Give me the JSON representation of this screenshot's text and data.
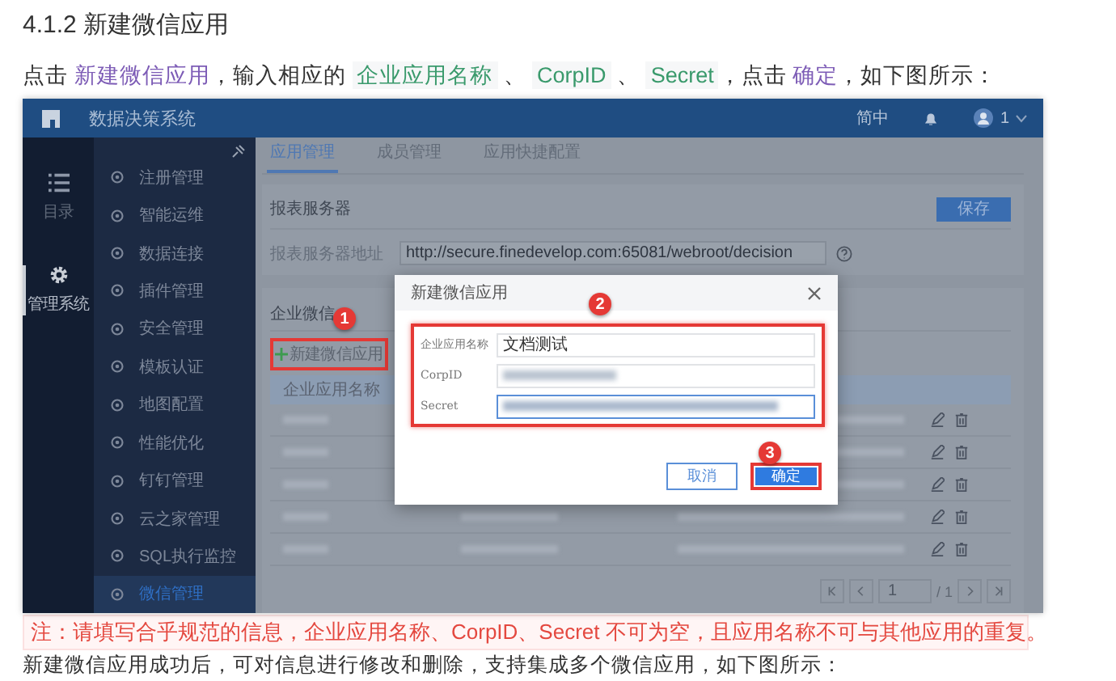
{
  "heading": "4.1.2 新建微信应用",
  "intro": [
    {
      "kind": "plain",
      "text": "点击 "
    },
    {
      "kind": "link",
      "text": "新建微信应用"
    },
    {
      "kind": "plain",
      "text": "，输入相应的 "
    },
    {
      "kind": "code",
      "text": "企业应用名称"
    },
    {
      "kind": "plain",
      "text": " 、 "
    },
    {
      "kind": "code",
      "text": "CorpID"
    },
    {
      "kind": "plain",
      "text": " 、 "
    },
    {
      "kind": "code",
      "text": "Secret"
    },
    {
      "kind": "plain",
      "text": "，点击 "
    },
    {
      "kind": "link",
      "text": "确定"
    },
    {
      "kind": "plain",
      "text": "，如下图所示："
    }
  ],
  "screenshot": {
    "topbar": {
      "title": "数据决策系统",
      "language": "简中",
      "user": "1"
    },
    "rail": [
      {
        "label": "目录",
        "selected": false
      },
      {
        "label": "管理系统",
        "selected": true
      }
    ],
    "sidebar": [
      {
        "label": "注册管理",
        "selected": false
      },
      {
        "label": "智能运维",
        "selected": false
      },
      {
        "label": "数据连接",
        "selected": false
      },
      {
        "label": "插件管理",
        "selected": false
      },
      {
        "label": "安全管理",
        "selected": false
      },
      {
        "label": "模板认证",
        "selected": false
      },
      {
        "label": "地图配置",
        "selected": false
      },
      {
        "label": "性能优化",
        "selected": false
      },
      {
        "label": "钉钉管理",
        "selected": false
      },
      {
        "label": "云之家管理",
        "selected": false
      },
      {
        "label": "SQL执行监控",
        "selected": false
      },
      {
        "label": "微信管理",
        "selected": true
      }
    ],
    "tabs": [
      {
        "label": "应用管理",
        "selected": true
      },
      {
        "label": "成员管理",
        "selected": false
      },
      {
        "label": "应用快捷配置",
        "selected": false
      }
    ],
    "server_card": {
      "title": "报表服务器",
      "save_button": "保存",
      "field_label": "报表服务器地址",
      "field_value": "http://secure.finedevelop.com:65081/webroot/decision"
    },
    "wechat_card": {
      "title": "企业微信",
      "add_button": {
        "label": "新建微信应用",
        "highlighted": true,
        "callout": "1"
      },
      "columns": [
        "企业应用名称"
      ]
    },
    "pagination": {
      "page": "1",
      "total": "/ 1"
    },
    "dialog": {
      "title": "新建微信应用",
      "callout": "2",
      "fields_highlighted": true,
      "fields": [
        {
          "label": "企业应用名称",
          "value": "文档测试",
          "focused": false
        },
        {
          "label": "CorpID",
          "focused": false
        },
        {
          "label": "Secret",
          "focused": true
        }
      ],
      "cancel_button": "取消",
      "confirm_button": {
        "label": "确定",
        "highlighted": true,
        "callout": "3"
      }
    }
  },
  "note": "注：请填写合乎规范的信息，企业应用名称、CorpID、Secret 不可为空，且应用名称不可与其他应用的重复。",
  "after": "新建微信应用成功后，可对信息进行修改和删除，支持集成多个微信应用，如下图所示："
}
